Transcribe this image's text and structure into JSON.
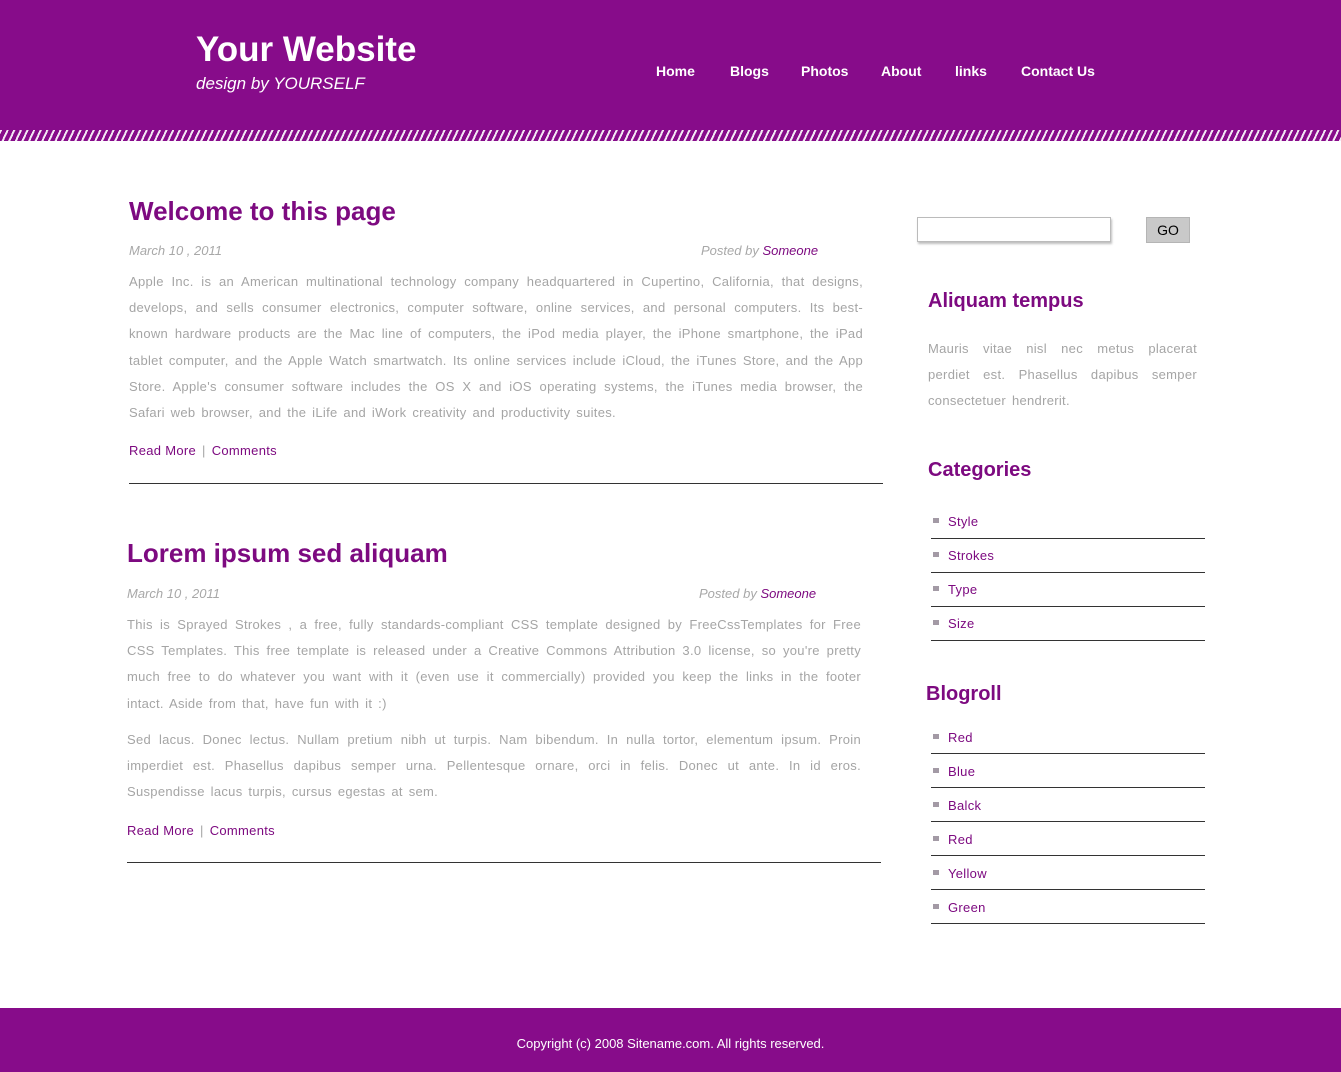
{
  "header": {
    "title": "Your Website",
    "tagline": "design by YOURSELF"
  },
  "nav": [
    {
      "label": "Home"
    },
    {
      "label": "Blogs"
    },
    {
      "label": "Photos"
    },
    {
      "label": "About"
    },
    {
      "label": "links"
    },
    {
      "label": "Contact Us"
    }
  ],
  "posts": [
    {
      "title": "Welcome to this page",
      "date": "March 10 , 2011",
      "posted_by": "Posted by",
      "author": "Someone",
      "paragraphs": [
        "Apple Inc. is an American multinational technology company headquartered in Cupertino, California, that designs, develops, and sells consumer electronics, computer software, online services, and personal computers. Its best-known hardware products are the Mac line of computers, the iPod media player, the iPhone smartphone, the iPad tablet computer, and the Apple Watch smartwatch. Its online services include iCloud, the iTunes Store, and the App Store. Apple's consumer software includes the OS X and iOS operating systems, the iTunes media browser, the Safari web browser, and the iLife and iWork creativity and productivity suites."
      ],
      "read_more": "Read More",
      "separator": "|",
      "comments": "Comments"
    },
    {
      "title": "Lorem ipsum sed aliquam",
      "date": "March 10 , 2011",
      "posted_by": "Posted by",
      "author": "Someone",
      "paragraphs": [
        "This is Sprayed Strokes , a free, fully standards-compliant CSS template designed by FreeCssTemplates for Free CSS Templates. This free template is released under a Creative Commons Attribution 3.0 license, so you're pretty much free to do whatever you want with it (even use it commercially) provided you keep the links in the footer intact. Aside from that, have fun with it :)",
        "Sed lacus. Donec lectus. Nullam pretium nibh ut turpis. Nam bibendum. In nulla tortor, elementum ipsum. Proin imperdiet est. Phasellus dapibus semper urna. Pellentesque ornare, orci in felis. Donec ut ante. In id eros. Suspendisse lacus turpis, cursus egestas at sem."
      ],
      "read_more": "Read More",
      "separator": "|",
      "comments": "Comments"
    }
  ],
  "sidebar": {
    "search": {
      "value": "",
      "button": "GO"
    },
    "about": {
      "heading": "Aliquam tempus",
      "text": "Mauris vitae nisl nec metus placerat perdiet est. Phasellus dapibus semper consectetuer hendrerit."
    },
    "categories": {
      "heading": "Categories",
      "items": [
        "Style",
        "Strokes",
        "Type",
        "Size"
      ]
    },
    "blogroll": {
      "heading": "Blogroll",
      "items": [
        "Red",
        "Blue",
        "Balck",
        "Red",
        "Yellow",
        "Green"
      ]
    }
  },
  "footer": {
    "copyright": "Copyright (c) 2008 Sitename.com. All rights reserved."
  },
  "colors": {
    "brand": "#870c8a",
    "link": "#7d0a80",
    "body_text": "#a5a5a5"
  }
}
